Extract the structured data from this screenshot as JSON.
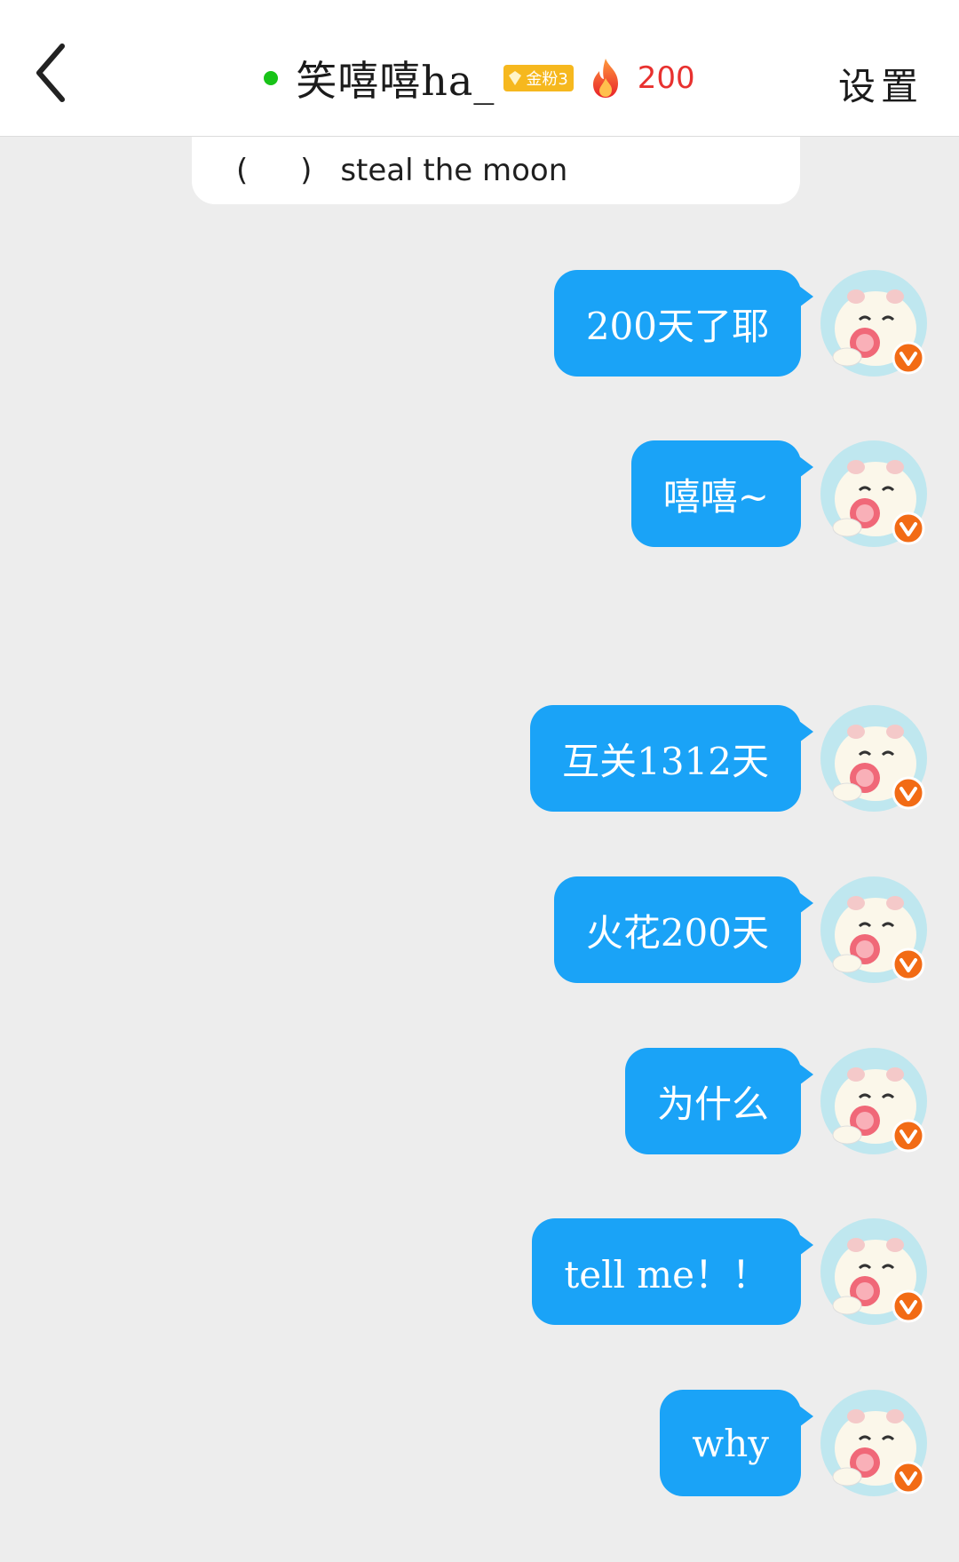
{
  "header": {
    "title": "笑嘻嘻ha_",
    "fan_badge": "金粉3",
    "streak_count": "200",
    "settings_label": "设置",
    "online_color": "#18c318"
  },
  "quoted_message": {
    "paren": "(  )",
    "text": "steal the moon"
  },
  "watermark": "",
  "messages": [
    {
      "text": "200天了耶"
    },
    {
      "text": "嘻嘻~"
    },
    {
      "text": "互关1312天"
    },
    {
      "text": "火花200天"
    },
    {
      "text": "为什么"
    },
    {
      "text": "tell me！！"
    },
    {
      "text": "why"
    }
  ],
  "colors": {
    "bubble": "#1aa3f7",
    "background": "#ededed",
    "streak": "#e8312f",
    "badge": "#f6b81e"
  }
}
